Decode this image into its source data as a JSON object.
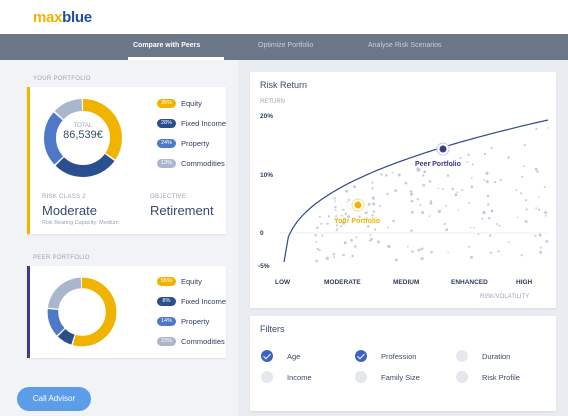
{
  "app": {
    "logo_main": "max",
    "logo_accent": "blue"
  },
  "nav": {
    "tabs": [
      {
        "label": "Compare with Peers",
        "active": true
      },
      {
        "label": "Optimize Portfolio",
        "active": false
      },
      {
        "label": "Analyse Risk Scenarios",
        "active": false
      }
    ]
  },
  "your_portfolio": {
    "section_label": "YOUR PORTFOLIO",
    "total_label": "TOTAL",
    "total_value": "86,539€",
    "accent_color": "#f0b400",
    "allocation": [
      {
        "pct": "35%",
        "label": "Equity",
        "value": 35,
        "color": "#f0b400"
      },
      {
        "pct": "28%",
        "label": "Fixed Income",
        "value": 28,
        "color": "#2a4f8f"
      },
      {
        "pct": "24%",
        "label": "Property",
        "value": 24,
        "color": "#4f78c8"
      },
      {
        "pct": "13%",
        "label": "Commodities",
        "value": 13,
        "color": "#aab6cc"
      }
    ],
    "risk_class_label": "RISK CLASS 2",
    "risk_class_value": "Moderate",
    "objective_label": "OBJECTIVE",
    "objective_value": "Retirement",
    "risk_capacity": "Risk Bearing Capacity: Medium"
  },
  "peer_portfolio": {
    "section_label": "PEER PORTFOLIO",
    "accent_color": "#3c3a8f",
    "allocation": [
      {
        "pct": "55%",
        "label": "Equity",
        "value": 55,
        "color": "#f0b400"
      },
      {
        "pct": "8%",
        "label": "Fixed Income",
        "value": 8,
        "color": "#2a4f8f"
      },
      {
        "pct": "14%",
        "label": "Property",
        "value": 14,
        "color": "#4f78c8"
      },
      {
        "pct": "23%",
        "label": "Commodities",
        "value": 23,
        "color": "#aab6cc"
      }
    ]
  },
  "risk_return": {
    "title": "Risk Return",
    "y_axis_label": "RETURN",
    "x_axis_label": "RISK/VOLATILITY",
    "y_ticks": [
      "20%",
      "10%",
      "0",
      "-5%"
    ],
    "x_ticks": [
      "LOW",
      "MODERATE",
      "MEDIUM",
      "ENHANCED",
      "HIGH"
    ],
    "your_label": "Your Portfolio",
    "peer_label": "Peer Portfolio",
    "your_color": "#f0b400",
    "peer_color": "#3c3a8f"
  },
  "chart_data": {
    "type": "scatter",
    "title": "Risk Return",
    "xlabel": "RISK/VOLATILITY",
    "ylabel": "RETURN",
    "x_categories": [
      "LOW",
      "MODERATE",
      "MEDIUM",
      "ENHANCED",
      "HIGH"
    ],
    "ylim": [
      -5,
      20
    ],
    "series": [
      {
        "name": "Your Portfolio",
        "points": [
          {
            "x": 1.4,
            "y": 6
          }
        ]
      },
      {
        "name": "Peer Portfolio",
        "points": [
          {
            "x": 2.8,
            "y": 13.5
          }
        ]
      }
    ]
  },
  "filters": {
    "title": "Filters",
    "items": [
      {
        "label": "Age",
        "checked": true
      },
      {
        "label": "Profession",
        "checked": true
      },
      {
        "label": "Duration",
        "checked": false
      },
      {
        "label": "Income",
        "checked": false
      },
      {
        "label": "Family Size",
        "checked": false
      },
      {
        "label": "Risk Profile",
        "checked": false
      }
    ]
  },
  "actions": {
    "call_advisor": "Call Advisor"
  }
}
